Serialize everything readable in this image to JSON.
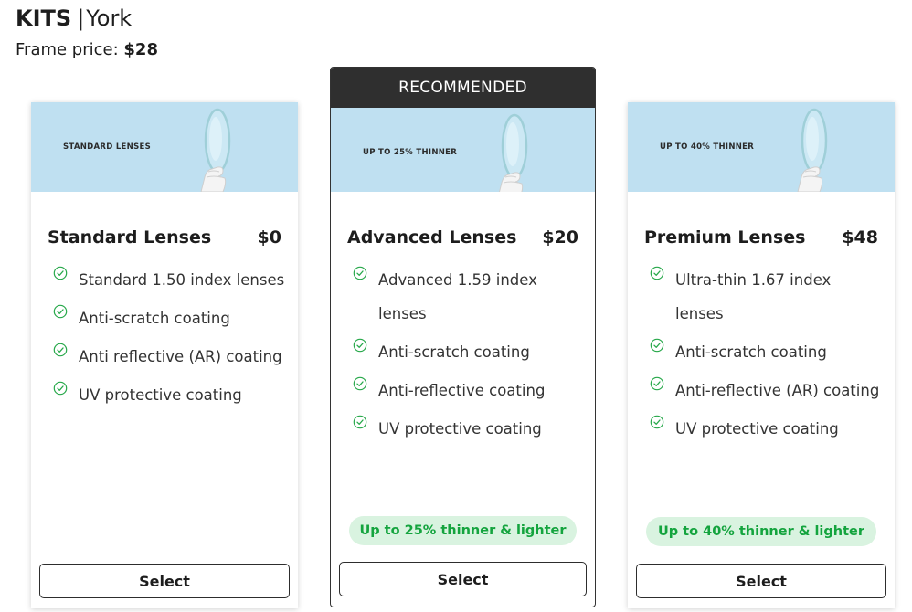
{
  "header": {
    "brand": "KITS",
    "separator": "|",
    "model": "York",
    "frame_price_label": "Frame price:",
    "frame_price_value": "$28"
  },
  "cards": [
    {
      "banner_text": "STANDARD LENSES",
      "name": "Standard Lenses",
      "price": "$0",
      "features": [
        "Standard 1.50 index lenses",
        "Anti-scratch coating",
        "Anti reflective (AR) coating",
        "UV protective coating"
      ],
      "select_label": "Select"
    },
    {
      "recommended_label": "RECOMMENDED",
      "banner_text": "UP TO 25% THINNER",
      "name": "Advanced Lenses",
      "price": "$20",
      "features": [
        "Advanced 1.59 index lenses",
        "Anti-scratch coating",
        "Anti-reflective coating",
        "UV protective coating"
      ],
      "highlight": "Up to 25% thinner & lighter",
      "select_label": "Select"
    },
    {
      "banner_text": "UP TO 40% THINNER",
      "name": "Premium Lenses",
      "price": "$48",
      "features": [
        "Ultra-thin 1.67 index lenses",
        "Anti-scratch coating",
        "Anti-reflective (AR) coating",
        "UV protective coating"
      ],
      "highlight": "Up to 40% thinner & lighter",
      "select_label": "Select"
    }
  ],
  "icons": {
    "feature": "check-circle-icon",
    "banner": "lens-held-by-gloved-hand"
  },
  "colors": {
    "banner_bg": "#bfe0f1",
    "check_green": "#27a84a",
    "pill_bg": "#d9f3e0",
    "pill_text": "#14a43e",
    "recommended_bg": "#2f2f2f"
  }
}
